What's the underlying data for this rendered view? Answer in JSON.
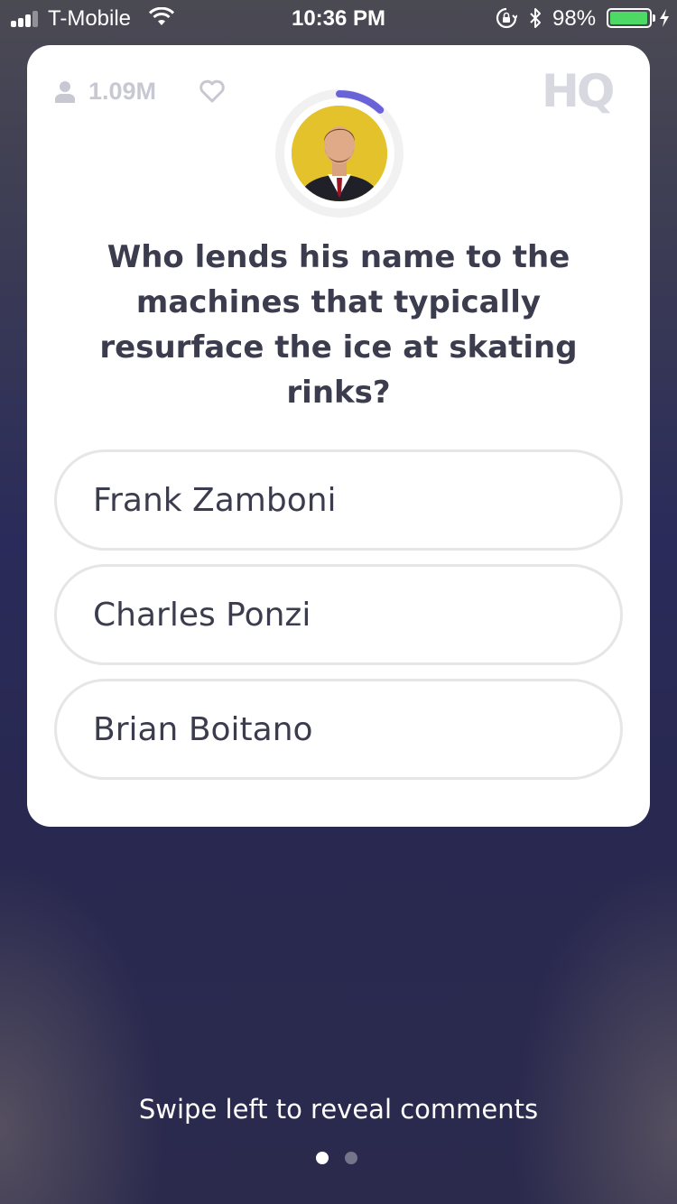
{
  "status_bar": {
    "carrier": "T-Mobile",
    "time": "10:36 PM",
    "battery_text": "98%",
    "battery_level": 0.98,
    "battery_color": "#4cd964"
  },
  "card": {
    "viewer_count": "1.09M",
    "logo_text": "HQ",
    "timer_progress": 0.12,
    "timer_color": "#6a63d8",
    "question": "Who lends his name to the machines that typically resurface the ice at skating rinks?",
    "answers": [
      {
        "label": "Frank Zamboni"
      },
      {
        "label": "Charles Ponzi"
      },
      {
        "label": "Brian Boitano"
      }
    ]
  },
  "footer": {
    "swipe_hint": "Swipe left to reveal comments",
    "page_index": 1,
    "page_count": 2
  }
}
